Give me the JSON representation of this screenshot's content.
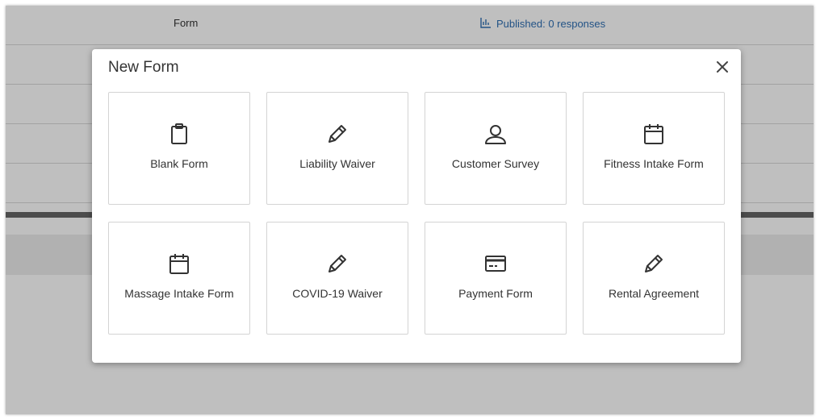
{
  "background": {
    "rows": [
      {
        "type": "Form",
        "status": "Published: 0 responses"
      }
    ]
  },
  "modal": {
    "title": "New Form",
    "close_icon": "close-icon",
    "templates": [
      {
        "label": "Blank Form",
        "icon": "clipboard-icon"
      },
      {
        "label": "Liability Waiver",
        "icon": "pencil-icon"
      },
      {
        "label": "Customer Survey",
        "icon": "user-icon"
      },
      {
        "label": "Fitness Intake Form",
        "icon": "calendar-icon"
      },
      {
        "label": "Massage Intake Form",
        "icon": "calendar-icon"
      },
      {
        "label": "COVID-19 Waiver",
        "icon": "pencil-icon"
      },
      {
        "label": "Payment Form",
        "icon": "credit-card-icon"
      },
      {
        "label": "Rental Agreement",
        "icon": "pencil-icon"
      }
    ]
  },
  "colors": {
    "link": "#2f6fb3",
    "text": "#333333",
    "card_border": "#d4d4d4",
    "icon": "#333333"
  }
}
